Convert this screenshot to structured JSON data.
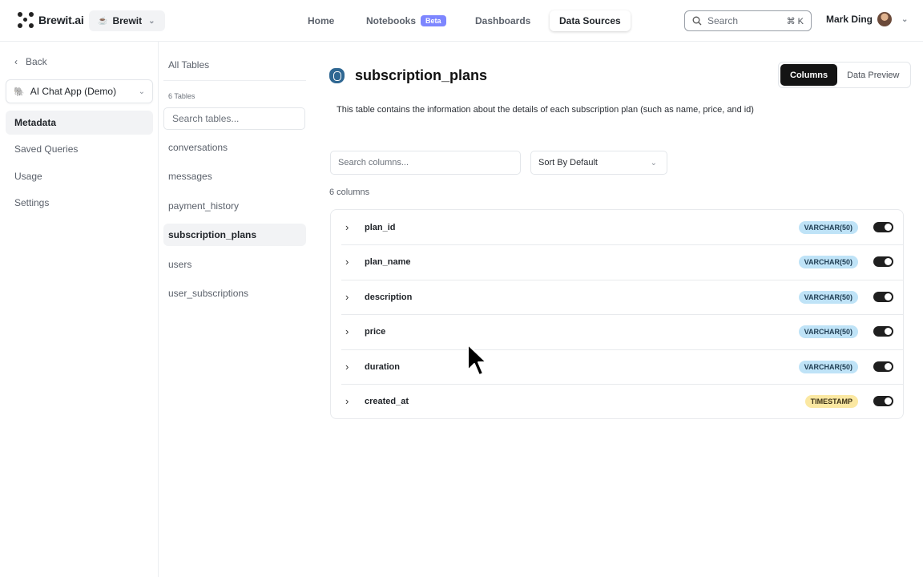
{
  "app": {
    "name": "Brewit.ai",
    "workspace": "Brewit"
  },
  "nav": [
    {
      "label": "Home"
    },
    {
      "label": "Notebooks",
      "badge": "Beta"
    },
    {
      "label": "Dashboards"
    },
    {
      "label": "Data Sources",
      "active": true
    }
  ],
  "search": {
    "placeholder": "Search",
    "shortcut": "⌘ K"
  },
  "user": {
    "name": "Mark Ding"
  },
  "sidebar": {
    "back_label": "Back",
    "project": "AI Chat App (Demo)",
    "items": [
      {
        "label": "Metadata",
        "active": true
      },
      {
        "label": "Saved Queries"
      },
      {
        "label": "Usage"
      },
      {
        "label": "Settings"
      }
    ]
  },
  "tables_panel": {
    "header": "All Tables",
    "count": "6 Tables",
    "search_placeholder": "Search tables...",
    "tables": [
      {
        "name": "conversations"
      },
      {
        "name": "messages"
      },
      {
        "name": "payment_history"
      },
      {
        "name": "subscription_plans",
        "active": true
      },
      {
        "name": "users"
      },
      {
        "name": "user_subscriptions"
      }
    ]
  },
  "main": {
    "table_name": "subscription_plans",
    "description": "This table contains the information about the details of each subscription plan (such as name, price, and id)",
    "view_tabs": [
      {
        "label": "Columns",
        "active": true
      },
      {
        "label": "Data Preview"
      }
    ],
    "columns_search_placeholder": "Search columns...",
    "sort_label": "Sort By Default",
    "columns_count": "6 columns",
    "columns": [
      {
        "name": "plan_id",
        "type": "VARCHAR(50)",
        "kind": "varchar",
        "enabled": true
      },
      {
        "name": "plan_name",
        "type": "VARCHAR(50)",
        "kind": "varchar",
        "enabled": true
      },
      {
        "name": "description",
        "type": "VARCHAR(50)",
        "kind": "varchar",
        "enabled": true
      },
      {
        "name": "price",
        "type": "VARCHAR(50)",
        "kind": "varchar",
        "enabled": true
      },
      {
        "name": "duration",
        "type": "VARCHAR(50)",
        "kind": "varchar",
        "enabled": true
      },
      {
        "name": "created_at",
        "type": "TIMESTAMP",
        "kind": "timestamp",
        "enabled": true
      }
    ]
  },
  "icons": {
    "logo": "brewit-logo-icon",
    "search": "search-icon",
    "back": "chevron-left-icon",
    "database": "postgres-icon",
    "expand": "chevron-right-icon",
    "dropdown": "chevron-down-icon"
  },
  "colors": {
    "active_tab": "#141414",
    "varchar_badge": "#bfe3f7",
    "timestamp_badge": "#fbe8a2",
    "beta_badge": "#7d86ff",
    "toggle_on": "#1f1f1f"
  }
}
